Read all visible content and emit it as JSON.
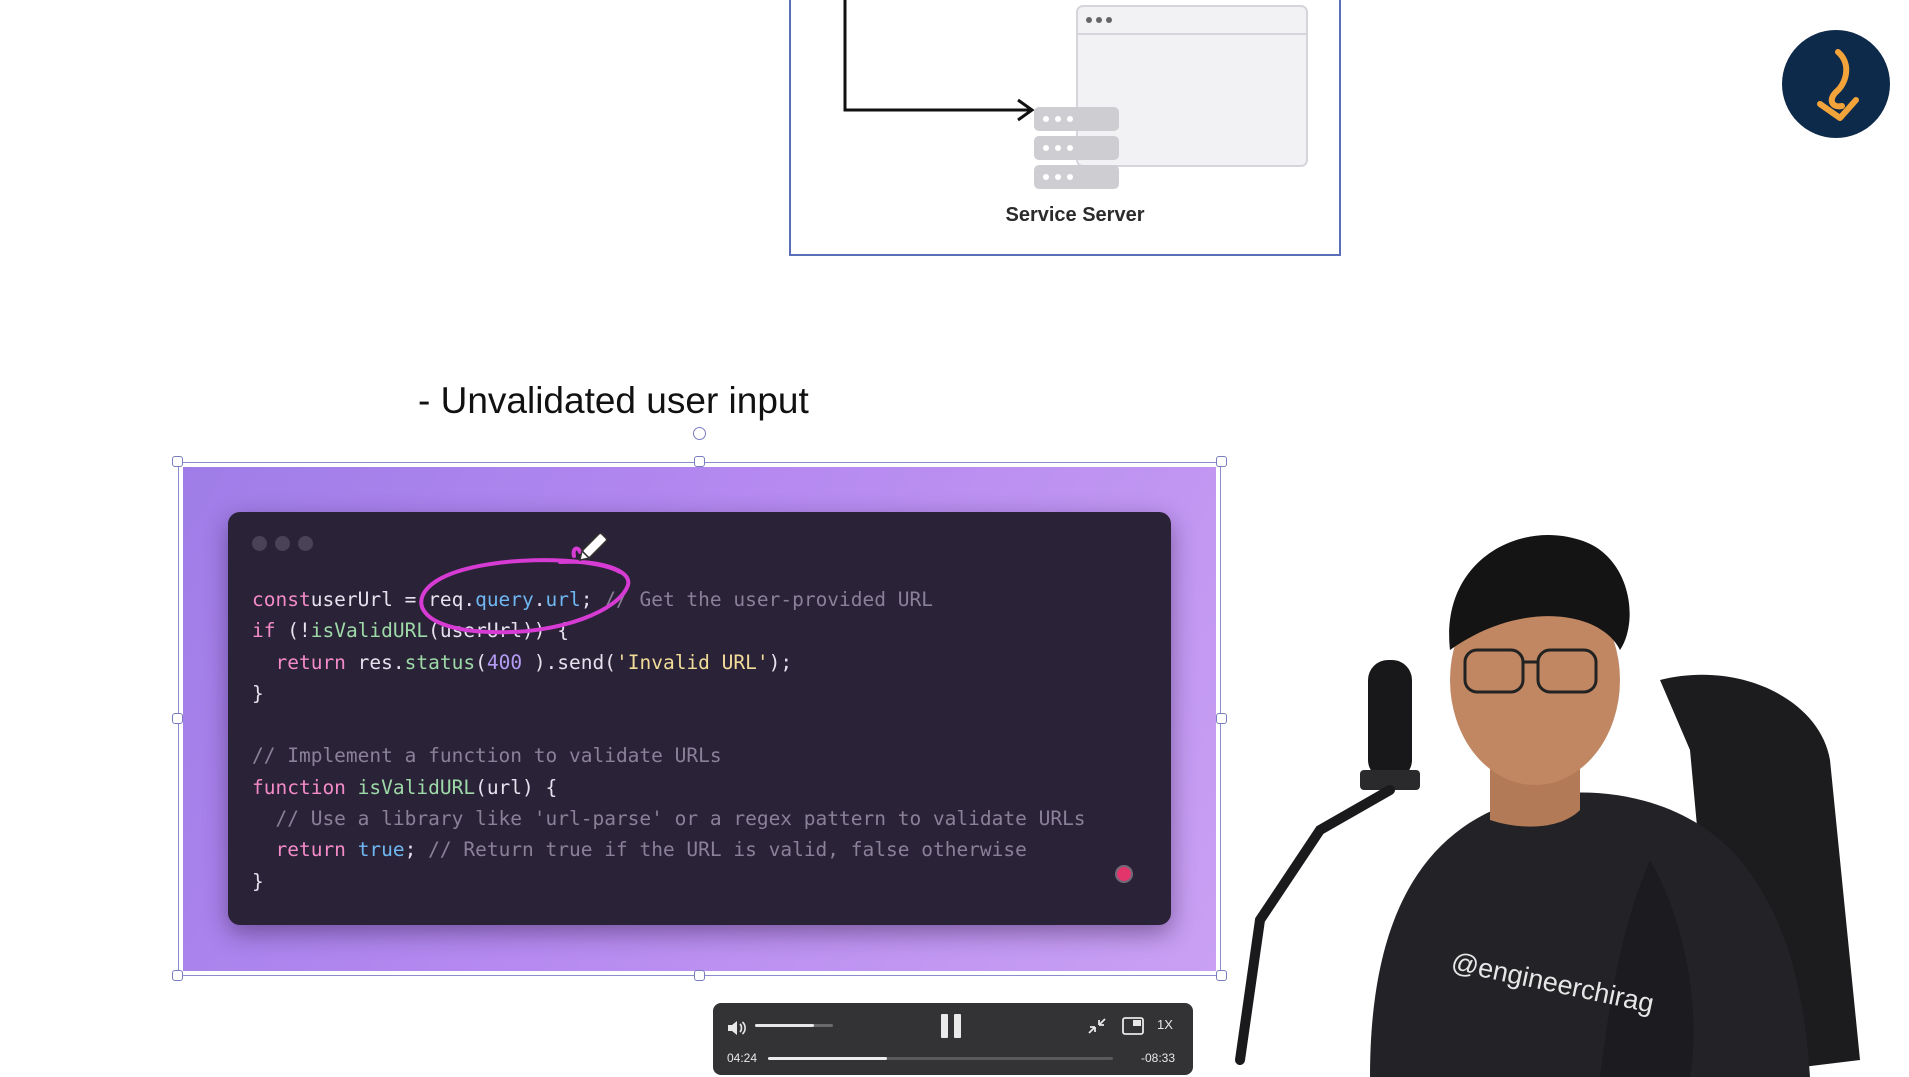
{
  "diagram": {
    "server_label": "Service Server"
  },
  "slide": {
    "heading": "- Unvalidated user input"
  },
  "code_lines": [
    [
      [
        "kw",
        "const"
      ],
      [
        "",
        "userUrl = req."
      ],
      [
        "prop",
        "query"
      ],
      [
        "",
        "."
      ],
      [
        "prop",
        "url"
      ],
      [
        "",
        "; "
      ],
      [
        "cm",
        "// Get the user-provided URL"
      ]
    ],
    [
      [
        "kw",
        "if"
      ],
      [
        "",
        " (!"
      ],
      [
        "fn",
        "isValidURL"
      ],
      [
        "",
        "(userUrl)) {"
      ]
    ],
    [
      [
        "",
        "  "
      ],
      [
        "kw",
        "return"
      ],
      [
        "",
        " res."
      ],
      [
        "fn",
        "status"
      ],
      [
        "",
        "("
      ],
      [
        "num",
        "400"
      ],
      [
        "",
        " ).send("
      ],
      [
        "str",
        "'Invalid URL'"
      ],
      [
        "",
        ");"
      ]
    ],
    [
      [
        "",
        "}"
      ]
    ],
    [
      [
        "",
        ""
      ]
    ],
    [
      [
        "cm",
        "// Implement a function to validate URLs"
      ]
    ],
    [
      [
        "kw",
        "function"
      ],
      [
        "",
        " "
      ],
      [
        "fn",
        "isValidURL"
      ],
      [
        "",
        "(url) {"
      ]
    ],
    [
      [
        "",
        "  "
      ],
      [
        "cm",
        "// Use a library like 'url-parse' or a regex pattern to validate URLs"
      ]
    ],
    [
      [
        "",
        "  "
      ],
      [
        "kw",
        "return"
      ],
      [
        "",
        " "
      ],
      [
        "prop",
        "true"
      ],
      [
        "",
        "; "
      ],
      [
        "cm",
        "// Return true if the URL is valid, false otherwise"
      ]
    ],
    [
      [
        "",
        "}"
      ]
    ]
  ],
  "player": {
    "elapsed": "04:24",
    "remaining": "-08:33",
    "speed": "1X",
    "progress": 0.346,
    "volume": 0.75
  },
  "presenter": {
    "shirt_text": "@engineerchirag"
  },
  "colors": {
    "accent_purple": "#b589f0",
    "code_bg": "#2a2236",
    "logo_bg": "#0e2a4a",
    "logo_mark": "#f2a33a"
  }
}
